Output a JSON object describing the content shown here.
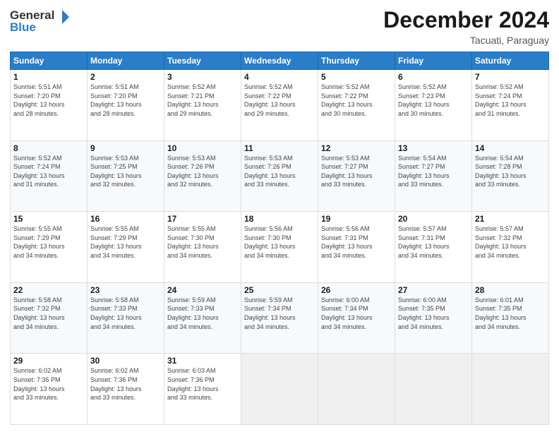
{
  "header": {
    "logo_general": "General",
    "logo_blue": "Blue",
    "month_title": "December 2024",
    "subtitle": "Tacuati, Paraguay"
  },
  "weekdays": [
    "Sunday",
    "Monday",
    "Tuesday",
    "Wednesday",
    "Thursday",
    "Friday",
    "Saturday"
  ],
  "weeks": [
    [
      {
        "day": "1",
        "info": "Sunrise: 5:51 AM\nSunset: 7:20 PM\nDaylight: 13 hours\nand 28 minutes."
      },
      {
        "day": "2",
        "info": "Sunrise: 5:51 AM\nSunset: 7:20 PM\nDaylight: 13 hours\nand 28 minutes."
      },
      {
        "day": "3",
        "info": "Sunrise: 5:52 AM\nSunset: 7:21 PM\nDaylight: 13 hours\nand 29 minutes."
      },
      {
        "day": "4",
        "info": "Sunrise: 5:52 AM\nSunset: 7:22 PM\nDaylight: 13 hours\nand 29 minutes."
      },
      {
        "day": "5",
        "info": "Sunrise: 5:52 AM\nSunset: 7:22 PM\nDaylight: 13 hours\nand 30 minutes."
      },
      {
        "day": "6",
        "info": "Sunrise: 5:52 AM\nSunset: 7:23 PM\nDaylight: 13 hours\nand 30 minutes."
      },
      {
        "day": "7",
        "info": "Sunrise: 5:52 AM\nSunset: 7:24 PM\nDaylight: 13 hours\nand 31 minutes."
      }
    ],
    [
      {
        "day": "8",
        "info": "Sunrise: 5:52 AM\nSunset: 7:24 PM\nDaylight: 13 hours\nand 31 minutes."
      },
      {
        "day": "9",
        "info": "Sunrise: 5:53 AM\nSunset: 7:25 PM\nDaylight: 13 hours\nand 32 minutes."
      },
      {
        "day": "10",
        "info": "Sunrise: 5:53 AM\nSunset: 7:26 PM\nDaylight: 13 hours\nand 32 minutes."
      },
      {
        "day": "11",
        "info": "Sunrise: 5:53 AM\nSunset: 7:26 PM\nDaylight: 13 hours\nand 33 minutes."
      },
      {
        "day": "12",
        "info": "Sunrise: 5:53 AM\nSunset: 7:27 PM\nDaylight: 13 hours\nand 33 minutes."
      },
      {
        "day": "13",
        "info": "Sunrise: 5:54 AM\nSunset: 7:27 PM\nDaylight: 13 hours\nand 33 minutes."
      },
      {
        "day": "14",
        "info": "Sunrise: 5:54 AM\nSunset: 7:28 PM\nDaylight: 13 hours\nand 33 minutes."
      }
    ],
    [
      {
        "day": "15",
        "info": "Sunrise: 5:55 AM\nSunset: 7:29 PM\nDaylight: 13 hours\nand 34 minutes."
      },
      {
        "day": "16",
        "info": "Sunrise: 5:55 AM\nSunset: 7:29 PM\nDaylight: 13 hours\nand 34 minutes."
      },
      {
        "day": "17",
        "info": "Sunrise: 5:55 AM\nSunset: 7:30 PM\nDaylight: 13 hours\nand 34 minutes."
      },
      {
        "day": "18",
        "info": "Sunrise: 5:56 AM\nSunset: 7:30 PM\nDaylight: 13 hours\nand 34 minutes."
      },
      {
        "day": "19",
        "info": "Sunrise: 5:56 AM\nSunset: 7:31 PM\nDaylight: 13 hours\nand 34 minutes."
      },
      {
        "day": "20",
        "info": "Sunrise: 5:57 AM\nSunset: 7:31 PM\nDaylight: 13 hours\nand 34 minutes."
      },
      {
        "day": "21",
        "info": "Sunrise: 5:57 AM\nSunset: 7:32 PM\nDaylight: 13 hours\nand 34 minutes."
      }
    ],
    [
      {
        "day": "22",
        "info": "Sunrise: 5:58 AM\nSunset: 7:32 PM\nDaylight: 13 hours\nand 34 minutes."
      },
      {
        "day": "23",
        "info": "Sunrise: 5:58 AM\nSunset: 7:33 PM\nDaylight: 13 hours\nand 34 minutes."
      },
      {
        "day": "24",
        "info": "Sunrise: 5:59 AM\nSunset: 7:33 PM\nDaylight: 13 hours\nand 34 minutes."
      },
      {
        "day": "25",
        "info": "Sunrise: 5:59 AM\nSunset: 7:34 PM\nDaylight: 13 hours\nand 34 minutes."
      },
      {
        "day": "26",
        "info": "Sunrise: 6:00 AM\nSunset: 7:34 PM\nDaylight: 13 hours\nand 34 minutes."
      },
      {
        "day": "27",
        "info": "Sunrise: 6:00 AM\nSunset: 7:35 PM\nDaylight: 13 hours\nand 34 minutes."
      },
      {
        "day": "28",
        "info": "Sunrise: 6:01 AM\nSunset: 7:35 PM\nDaylight: 13 hours\nand 34 minutes."
      }
    ],
    [
      {
        "day": "29",
        "info": "Sunrise: 6:02 AM\nSunset: 7:35 PM\nDaylight: 13 hours\nand 33 minutes."
      },
      {
        "day": "30",
        "info": "Sunrise: 6:02 AM\nSunset: 7:36 PM\nDaylight: 13 hours\nand 33 minutes."
      },
      {
        "day": "31",
        "info": "Sunrise: 6:03 AM\nSunset: 7:36 PM\nDaylight: 13 hours\nand 33 minutes."
      },
      {
        "day": "",
        "info": ""
      },
      {
        "day": "",
        "info": ""
      },
      {
        "day": "",
        "info": ""
      },
      {
        "day": "",
        "info": ""
      }
    ]
  ]
}
